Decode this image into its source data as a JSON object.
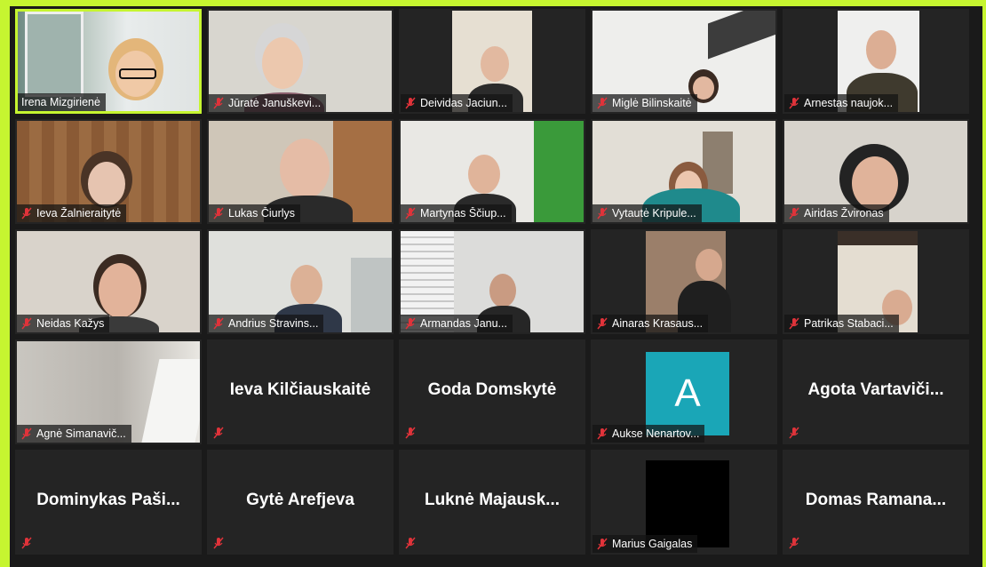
{
  "meeting": {
    "participants": [
      {
        "name": "Irena Mizgirienė",
        "muted": false,
        "video": true,
        "active": true
      },
      {
        "name": "Jūratė Januškevi...",
        "muted": true,
        "video": true
      },
      {
        "name": "Deividas Jaciun...",
        "muted": true,
        "video": true
      },
      {
        "name": "Miglė Bilinskaitė",
        "muted": true,
        "video": true
      },
      {
        "name": "Arnestas naujok...",
        "muted": true,
        "video": true
      },
      {
        "name": "Ieva Žalnieraitytė",
        "muted": true,
        "video": true
      },
      {
        "name": "Lukas Čiurlys",
        "muted": true,
        "video": true
      },
      {
        "name": "Martynas Ščiup...",
        "muted": true,
        "video": true
      },
      {
        "name": "Vytautė Kripule...",
        "muted": true,
        "video": true
      },
      {
        "name": "Airidas Žvironas",
        "muted": true,
        "video": true
      },
      {
        "name": "Neidas Kažys",
        "muted": true,
        "video": true
      },
      {
        "name": "Andrius Stravins...",
        "muted": true,
        "video": true
      },
      {
        "name": "Armandas Janu...",
        "muted": true,
        "video": true
      },
      {
        "name": "Ainaras Krasaus...",
        "muted": true,
        "video": true
      },
      {
        "name": "Patrikas Stabaci...",
        "muted": true,
        "video": true
      },
      {
        "name": "Agnė Simanavič...",
        "muted": true,
        "video": true
      },
      {
        "name": "Ieva Kilčiauskaitė",
        "muted": true,
        "video": false
      },
      {
        "name": "Goda Domskytė",
        "muted": true,
        "video": false
      },
      {
        "name": "Aukse Nenartov...",
        "muted": true,
        "video": false,
        "avatar_letter": "A"
      },
      {
        "name": "Agota  Vartaviči...",
        "muted": true,
        "video": false
      },
      {
        "name": "Dominykas  Paši...",
        "muted": true,
        "video": false
      },
      {
        "name": "Gytė Arefjeva",
        "muted": true,
        "video": false
      },
      {
        "name": "Luknė  Majausk...",
        "muted": true,
        "video": false
      },
      {
        "name": "Marius Gaigalas",
        "muted": true,
        "video": false,
        "black": true
      },
      {
        "name": "Domas  Ramana...",
        "muted": true,
        "video": false
      }
    ]
  },
  "colors": {
    "frame": "#c6f530",
    "mute": "#e0333a",
    "avatar": "#1aa6b7"
  }
}
